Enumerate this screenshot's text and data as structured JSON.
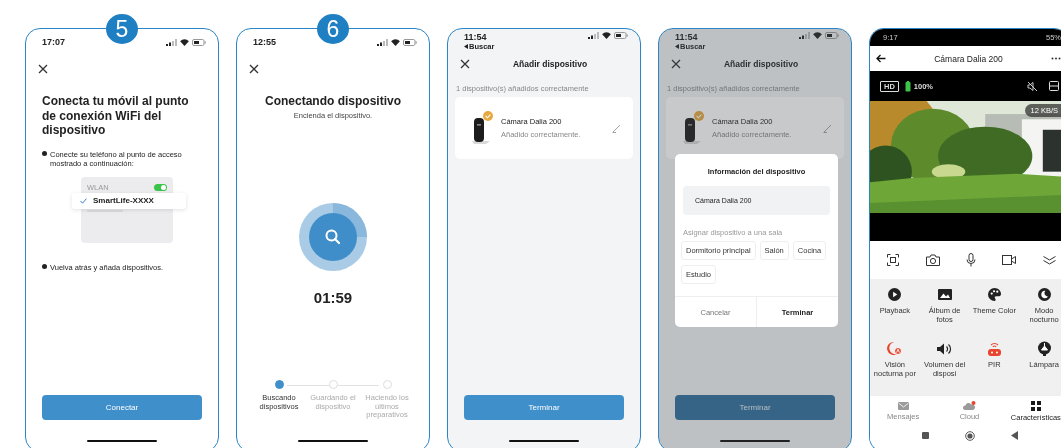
{
  "screens": [
    {
      "kind": "wifi_setup",
      "step": "5",
      "time": "17:07",
      "title": "Conecta tu móvil al punto de conexión WiFi del dispositivo",
      "instructions": [
        "Conecte su teléfono al punto de acceso mostrado a continuación:",
        "Vuelva atrás y añada dispositivos."
      ],
      "wlan": {
        "label": "WLAN",
        "on": true,
        "network": "SmartLife-XXXX"
      },
      "button": "Conectar"
    },
    {
      "kind": "connecting",
      "step": "6",
      "time": "12:55",
      "title": "Conectando dispositivo",
      "subtitle": "Encienda el dispositivo.",
      "timer": "01:59",
      "steps": [
        {
          "label": "Buscando dispositivos",
          "selected": true
        },
        {
          "label": "Guardando el dispositivo",
          "selected": false
        },
        {
          "label": "Haciendo los últimos preparativos",
          "selected": false
        }
      ]
    },
    {
      "kind": "device_added",
      "time": "11:54",
      "back": "Buscar",
      "title": "Añadir dispositivo",
      "note": "1 dispositivo(s) añadidos correctamente",
      "device": {
        "name": "Cámara Dalia 200",
        "status": "Añadido correctamente."
      },
      "button": "Terminar"
    },
    {
      "kind": "device_added",
      "time": "11:54",
      "back": "Buscar",
      "title": "Añadir dispositivo",
      "note": "1 dispositivo(s) añadidos correctamente",
      "device": {
        "name": "Cámara Dalia 200",
        "status": "Añadido correctamente."
      },
      "button": "Terminar",
      "dialog": {
        "title": "Información del dispositivo",
        "name": "Cámara Dalia 200",
        "room_label": "Asignar dispositivo a una sala",
        "rooms": [
          {
            "label": "Dormitorio principal",
            "selected": false
          },
          {
            "label": "Salón",
            "selected": false
          },
          {
            "label": "Cocina",
            "selected": false
          },
          {
            "label": "Estudio",
            "selected": false
          }
        ],
        "cancel": "Cancelar",
        "confirm": "Terminar"
      }
    },
    {
      "kind": "camera_live",
      "time": "9:17",
      "battery_text": "55%",
      "title": "Cámara Dalia 200",
      "quality": "HD",
      "battery": "100%",
      "speed": "12 KB/S",
      "features": [
        {
          "label": "Playback",
          "kind": "play",
          "color": "#222222"
        },
        {
          "label": "Álbum de fotos",
          "kind": "album",
          "color": "#222222"
        },
        {
          "label": "Theme Color",
          "kind": "palette",
          "color": "#222222"
        },
        {
          "label": "Modo nocturno",
          "kind": "moon",
          "color": "#222222"
        },
        {
          "label": "Visión nocturna por",
          "kind": "night",
          "color": "#e8452f"
        },
        {
          "label": "Volumen del disposi",
          "kind": "volume",
          "color": "#222222"
        },
        {
          "label": "PIR",
          "kind": "pir",
          "color": "#e8452f"
        },
        {
          "label": "Lámpara",
          "kind": "lamp",
          "color": "#222222"
        }
      ],
      "nav": [
        {
          "label": "Mensajes",
          "kind": "mail",
          "selected": false
        },
        {
          "label": "Cloud",
          "kind": "cloud",
          "selected": false
        },
        {
          "label": "Características",
          "kind": "grid",
          "selected": true
        }
      ]
    }
  ]
}
